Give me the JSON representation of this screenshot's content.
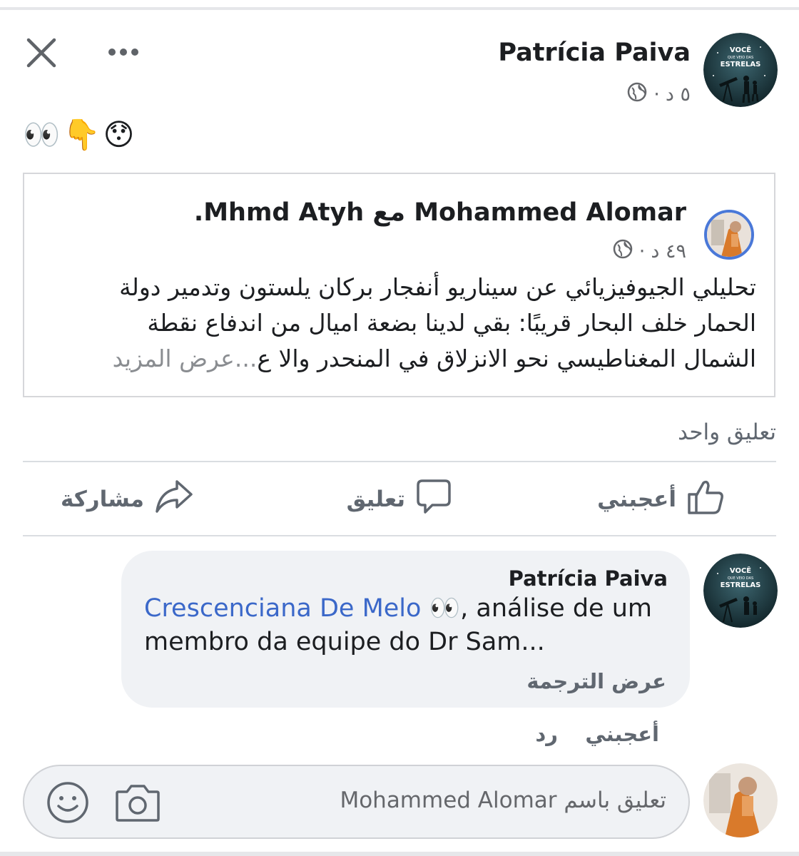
{
  "post": {
    "author": "Patrícia Paiva",
    "time": "٥ د",
    "separator": "·",
    "text": "👀👇😯",
    "avatar_lines": [
      "VOCÊ",
      "QUE VEIO DAS",
      "ESTRELAS"
    ]
  },
  "shared": {
    "author": "Mohammed Alomar",
    "with_word": "مع",
    "tagged": "Mhmd Atyh",
    "dot": ".",
    "time": "٤٩ د",
    "separator": "·",
    "lines": [
      "تحليلي الجيوفيزيائي عن سيناريو أنفجار بركان يلستون وتدمير دولة",
      "الحمار خلف البحار قريبًا: بقي لدينا بضعة اميال من اندفاع نقطة",
      "الشمال المغناطيسي نحو الانزلاق في المنحدر والا ع"
    ],
    "see_more": "...عرض المزيد"
  },
  "comment_count": "تعليق واحد",
  "actions": {
    "like": "أعجبني",
    "comment": "تعليق",
    "share": "مشاركة"
  },
  "comment": {
    "author": "Patrícia Paiva",
    "mention": "Crescenciana De Melo",
    "text": " 👀, análise de um membro da equipe do Dr Sam...",
    "translate": "عرض الترجمة",
    "like": "أعجبني",
    "reply": "رد"
  },
  "composer": {
    "placeholder": "تعليق باسم Mohammed Alomar"
  }
}
